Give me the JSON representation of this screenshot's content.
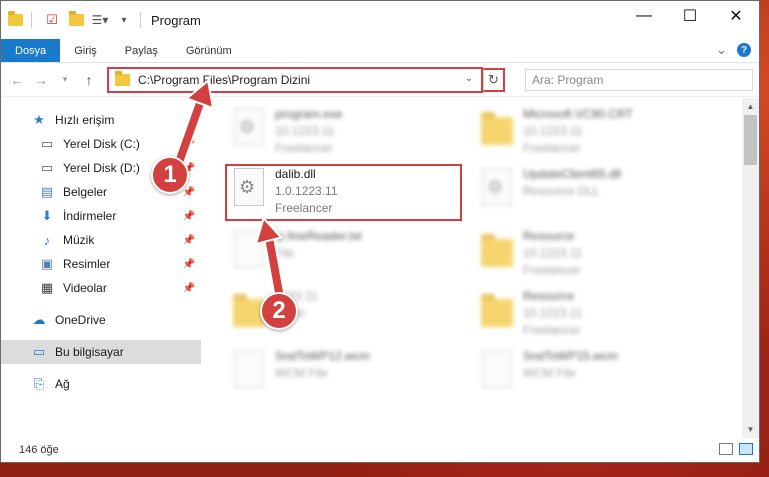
{
  "window": {
    "title": "Program",
    "controls": {
      "minimize": "—",
      "maximize": "☐",
      "close": "✕"
    }
  },
  "ribbon": {
    "tabs": [
      "Dosya",
      "Giriş",
      "Paylaş",
      "Görünüm"
    ],
    "expand": "⌄",
    "help": "?"
  },
  "address": {
    "path": "C:\\Program Files\\Program Dizini",
    "search_placeholder": "Ara: Program"
  },
  "sidebar": {
    "quick_access": "Hızlı erişim",
    "items": [
      {
        "label": "Yerel Disk (C:)",
        "icon": "drive-icon"
      },
      {
        "label": "Yerel Disk (D:)",
        "icon": "drive-icon"
      },
      {
        "label": "Belgeler",
        "icon": "documents-icon"
      },
      {
        "label": "İndirmeler",
        "icon": "download-icon"
      },
      {
        "label": "Müzik",
        "icon": "music-icon"
      },
      {
        "label": "Resimler",
        "icon": "pictures-icon"
      },
      {
        "label": "Videolar",
        "icon": "video-icon"
      }
    ],
    "onedrive": "OneDrive",
    "this_pc": "Bu bilgisayar",
    "network": "Ağ"
  },
  "files": [
    {
      "name": "program.exe",
      "version": "10.1223.11",
      "company": "Freelancer",
      "kind": "exe"
    },
    {
      "name": "Microsoft.VC90.CRT",
      "version": "10.1223.11",
      "company": "Freelancer",
      "kind": "folder"
    },
    {
      "name": "dalib.dll",
      "version": "1.0.1223.11",
      "company": "Freelancer",
      "kind": "dll"
    },
    {
      "name": "UpdateClient65.dll",
      "version": "Resource DLL",
      "company": "",
      "kind": "dll"
    },
    {
      "name": "ip.fineReader.txt",
      "version": "File",
      "company": "",
      "kind": "doc"
    },
    {
      "name": "Resource",
      "version": "10.1223.11",
      "company": "Freelancer",
      "kind": "folder"
    },
    {
      "name": "",
      "version": "1223.11",
      "company": "ancer",
      "kind": "folder"
    },
    {
      "name": "Resource",
      "version": "10.1223.11",
      "company": "Freelancer",
      "kind": "folder"
    },
    {
      "name": "SndToWP12.wcm",
      "version": "WCM File",
      "company": "",
      "kind": "doc"
    },
    {
      "name": "SndToWP15.wcm",
      "version": "WCM File",
      "company": "",
      "kind": "doc"
    }
  ],
  "status": {
    "count": "146 öğe"
  },
  "callouts": {
    "one": "1",
    "two": "2"
  },
  "colors": {
    "accent": "#1979ca",
    "highlight": "#d14040",
    "folder": "#f3c83f"
  }
}
